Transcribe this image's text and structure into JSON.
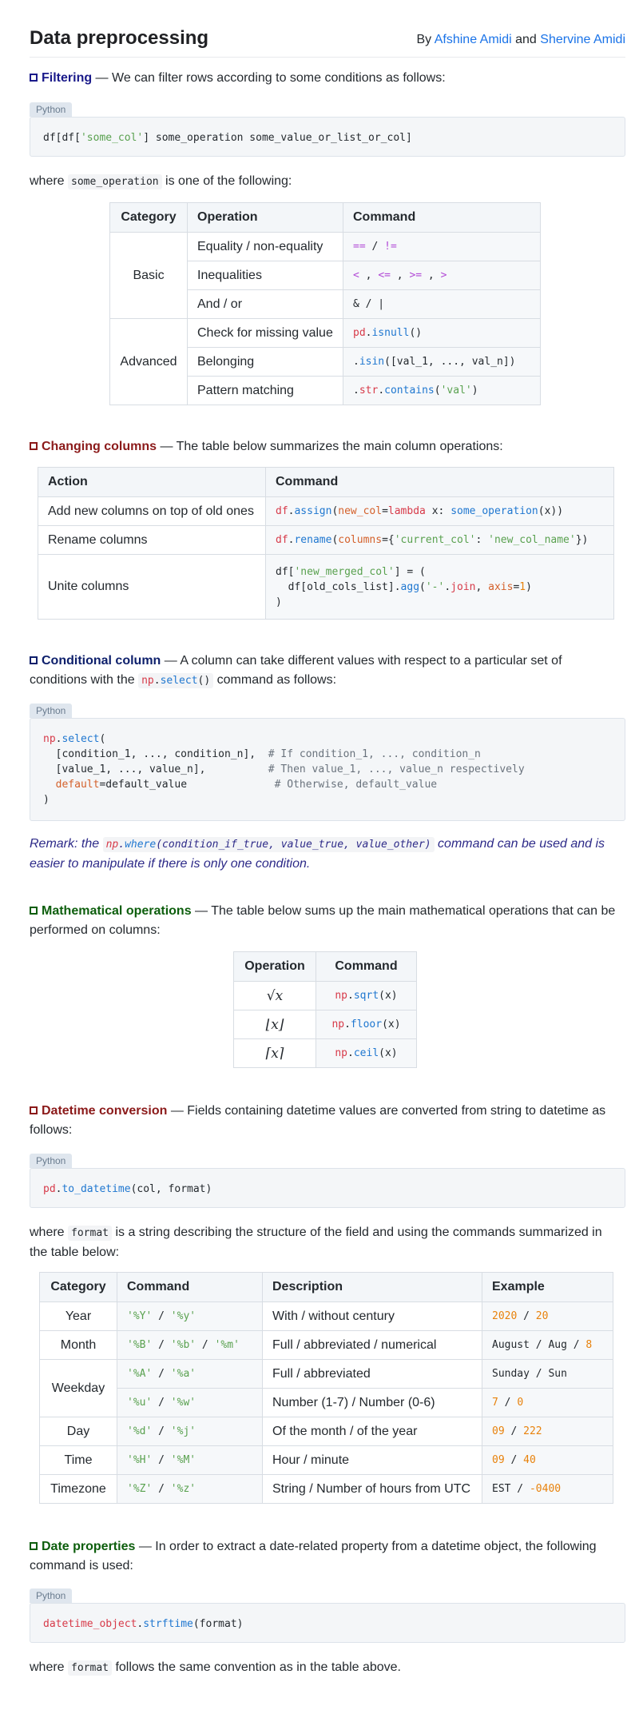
{
  "header": {
    "title": "Data preprocessing",
    "by": "By",
    "and": "and",
    "author1": "Afshine Amidi",
    "author2": "Shervine Amidi"
  },
  "lang_label": "Python",
  "filtering": {
    "title": "Filtering",
    "desc": " — We can filter rows according to some conditions as follows:",
    "code_prefix": "df[df[",
    "code_string": "'some_col'",
    "code_suffix": "] some_operation some_value_or_list_or_col]",
    "where_pre": "where ",
    "where_code": "some_operation",
    "where_post": " is one of the following:",
    "table": {
      "headers": [
        "Category",
        "Operation",
        "Command"
      ],
      "cat_basic": "Basic",
      "cat_advanced": "Advanced",
      "ops": [
        "Equality / non-equality",
        "Inequalities",
        "And / or",
        "Check for missing value",
        "Belonging",
        "Pattern matching"
      ]
    }
  },
  "changing": {
    "title": "Changing columns",
    "desc": " — The table below summarizes the main column operations:",
    "headers": [
      "Action",
      "Command"
    ],
    "actions": [
      "Add new columns on top of old ones",
      "Rename columns",
      "Unite columns"
    ]
  },
  "conditional": {
    "title": "Conditional column",
    "desc1": " — A column can take different values with respect to a particular set of",
    "desc2": "conditions with the ",
    "desc3": " command as follows:",
    "remark1": "Remark: the ",
    "remark2": "(condition_if_true, value_true, value_other)",
    "remark3": " command can be used and is",
    "remark4": "easier to manipulate if there is only one condition."
  },
  "math": {
    "title": "Mathematical operations",
    "desc1": " — The table below sums up the main mathematical operations that can be",
    "desc2": "performed on columns:",
    "headers": [
      "Operation",
      "Command"
    ],
    "rows": [
      {
        "sym": "√x",
        "fn": "sqrt"
      },
      {
        "sym": "⌊x⌋",
        "fn": "floor"
      },
      {
        "sym": "⌈x⌉",
        "fn": "ceil"
      }
    ]
  },
  "datetime": {
    "title": "Datetime conversion",
    "desc1": " — Fields containing datetime values are converted from string to datetime as",
    "desc2": "follows:",
    "where1_pre": "where ",
    "where1_code": "format",
    "where1_post": " is a string describing the structure of the field and using the commands summarized in",
    "where2": "the table below:",
    "headers": [
      "Category",
      "Command",
      "Description",
      "Example"
    ],
    "categories": [
      "Year",
      "Month",
      "Weekday",
      "Day",
      "Time",
      "Timezone"
    ],
    "descriptions": [
      "With / without century",
      "Full / abbreviated / numerical",
      "Full / abbreviated",
      "Number (1-7) / Number (0-6)",
      "Of the month / of the year",
      "Hour / minute",
      "String / Number of hours from UTC"
    ]
  },
  "dateprops": {
    "title": "Date properties",
    "desc1": " — In order to extract a date-related property from a datetime object, the following",
    "desc2": "command is used:",
    "where_pre": "where ",
    "where_code": "format",
    "where_post": " follows the same convention as in the table above."
  },
  "colors": {
    "filtering": "#1a1a8a",
    "changing": "#8b1a1a",
    "conditional": "#0d1f6b",
    "math": "#0d5e0d",
    "datetime": "#8b1a1a",
    "dateprops": "#0d5e0d",
    "link": "#1a73e8"
  }
}
